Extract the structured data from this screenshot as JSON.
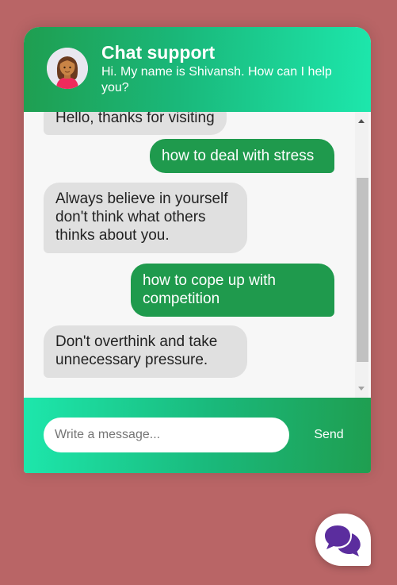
{
  "header": {
    "title": "Chat support",
    "subtitle": "Hi. My name is Shivansh. How can I help you?"
  },
  "messages": [
    {
      "from": "operator",
      "text": "Hello, thanks for visiting"
    },
    {
      "from": "visitor",
      "text": "how to deal with stress"
    },
    {
      "from": "operator",
      "text": "Always believe in yourself don't think what others thinks about you."
    },
    {
      "from": "visitor",
      "text": "how to cope up with competition"
    },
    {
      "from": "operator",
      "text": "Don't overthink and take unnecessary pressure."
    }
  ],
  "footer": {
    "input_placeholder": "Write a message...",
    "input_value": "",
    "send_label": "Send"
  },
  "icons": {
    "avatar": "woman-avatar-icon",
    "toggle": "chat-bubbles-icon"
  },
  "colors": {
    "page_background": "#b96566",
    "brand_green": "#1f9a4d",
    "brand_mint": "#1de7ac",
    "operator_bubble": "#e0e0e0",
    "toggle_icon": "#5b2d9e"
  }
}
